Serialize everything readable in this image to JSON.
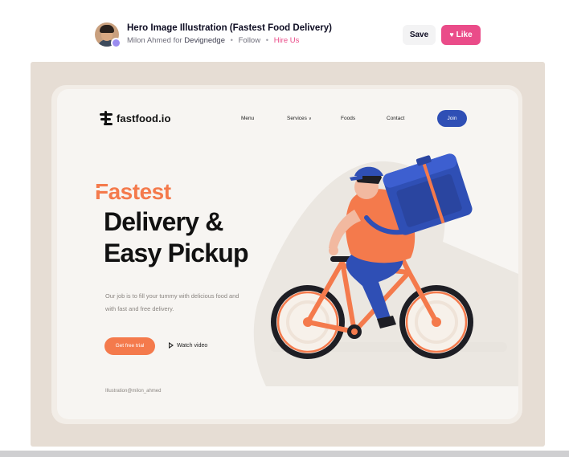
{
  "shot": {
    "title": "Hero Image Illustration (Fastest Food Delivery)",
    "author": "Milon Ahmed",
    "for_word": "for",
    "team": "Devignedge",
    "follow": "Follow",
    "hire": "Hire Us",
    "save_label": "Save",
    "like_label": "Like"
  },
  "landing": {
    "logo_text": "fastfood.io",
    "nav": [
      "Menu",
      "Services",
      "Foods",
      "Contact"
    ],
    "join_label": "Join",
    "hero_accent": "Fastest",
    "hero_line1": "Delivery &",
    "hero_line2": "Easy Pickup",
    "description": "Our job is to fill your tummy with delicious food and with fast and free delivery.",
    "cta_label": "Get free trial",
    "watch_label": "Watch video",
    "credit": "Illustration@milon_ahmed"
  },
  "colors": {
    "accent": "#f47a4c",
    "brand_blue": "#2f4fb5",
    "like_pink": "#ea4c89",
    "frame_bg": "#e6ddd4",
    "card_bg": "#f7f5f2"
  },
  "icons": [
    "user-avatar",
    "team-badge-icon",
    "heart-icon",
    "logo-mark-icon",
    "chevron-down-icon",
    "play-icon"
  ]
}
